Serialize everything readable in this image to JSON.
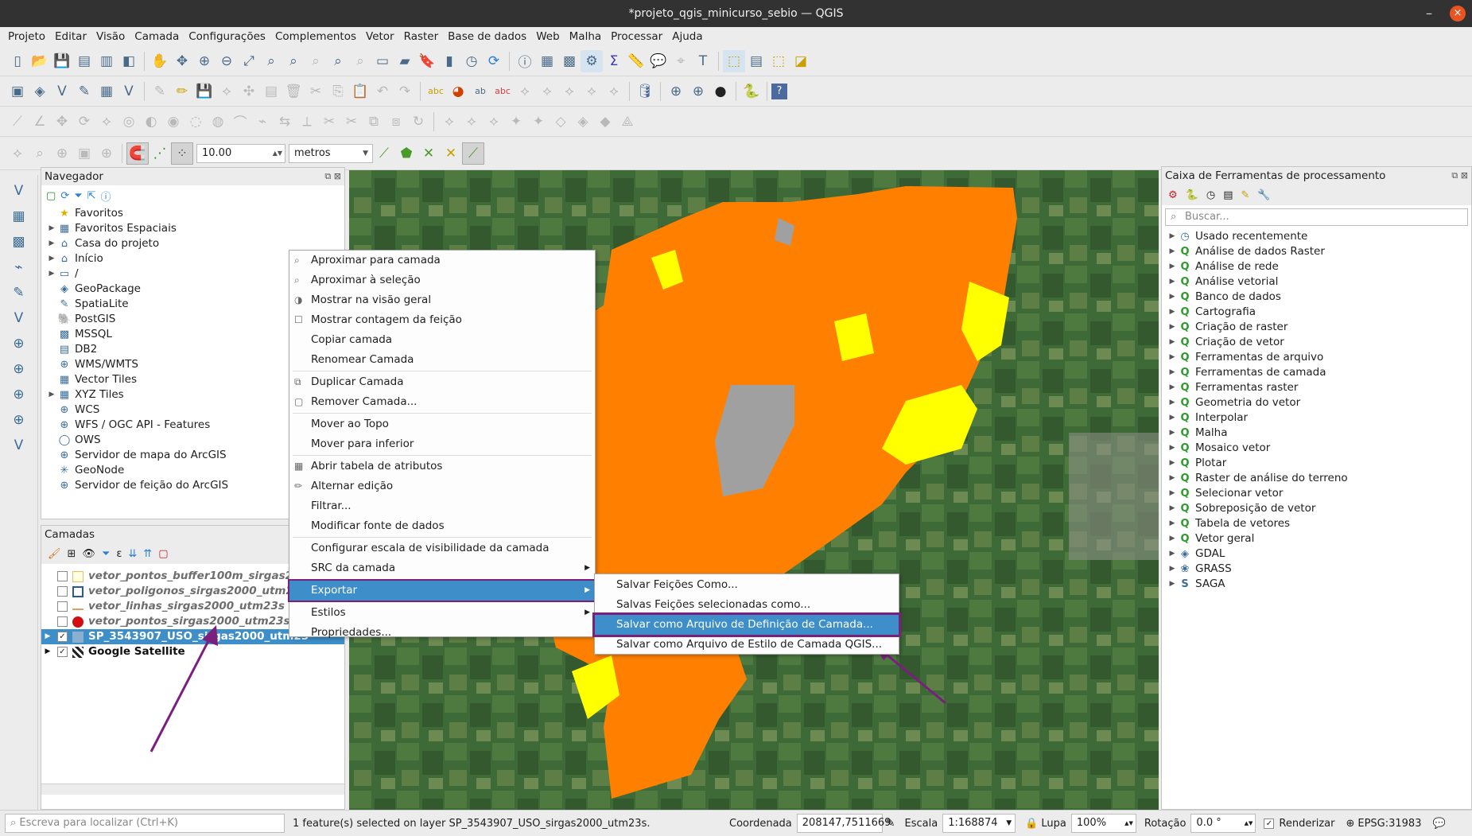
{
  "window": {
    "title": "*projeto_qgis_minicurso_sebio — QGIS",
    "minimize": "–",
    "maximize": "□",
    "close": "×"
  },
  "menubar": [
    "Projeto",
    "Editar",
    "Visão",
    "Camada",
    "Configurações",
    "Complementos",
    "Vetor",
    "Raster",
    "Base de dados",
    "Web",
    "Malha",
    "Processar",
    "Ajuda"
  ],
  "snapping": {
    "tolerance": "10.00",
    "units": "metros"
  },
  "navigator": {
    "title": "Navegador",
    "items": [
      {
        "label": "Favoritos",
        "icon": "star-icon",
        "expand": false
      },
      {
        "label": "Favoritos Espaciais",
        "icon": "spatial-bookmark-icon",
        "expand": true
      },
      {
        "label": "Casa do projeto",
        "icon": "project-home-icon",
        "expand": true
      },
      {
        "label": "Início",
        "icon": "home-icon",
        "expand": true
      },
      {
        "label": "/",
        "icon": "folder-icon",
        "expand": true
      },
      {
        "label": "GeoPackage",
        "icon": "geopackage-icon",
        "expand": false
      },
      {
        "label": "SpatiaLite",
        "icon": "spatialite-icon",
        "expand": false
      },
      {
        "label": "PostGIS",
        "icon": "postgis-icon",
        "expand": false
      },
      {
        "label": "MSSQL",
        "icon": "mssql-icon",
        "expand": false
      },
      {
        "label": "DB2",
        "icon": "db2-icon",
        "expand": false
      },
      {
        "label": "WMS/WMTS",
        "icon": "wms-icon",
        "expand": false
      },
      {
        "label": "Vector Tiles",
        "icon": "vector-tiles-icon",
        "expand": false
      },
      {
        "label": "XYZ Tiles",
        "icon": "xyz-tiles-icon",
        "expand": true
      },
      {
        "label": "WCS",
        "icon": "wcs-icon",
        "expand": false
      },
      {
        "label": "WFS / OGC API - Features",
        "icon": "wfs-icon",
        "expand": false
      },
      {
        "label": "OWS",
        "icon": "ows-icon",
        "expand": false
      },
      {
        "label": "Servidor de mapa do ArcGIS",
        "icon": "arcgis-map-icon",
        "expand": false
      },
      {
        "label": "GeoNode",
        "icon": "geonode-icon",
        "expand": false
      },
      {
        "label": "Servidor de feição do ArcGIS",
        "icon": "arcgis-feature-icon",
        "expand": false
      }
    ]
  },
  "layers": {
    "title": "Camadas",
    "items": [
      {
        "label": "vetor_pontos_buffer100m_sirgas2",
        "checked": false
      },
      {
        "label": "vetor_poligonos_sirgas2000_utm2",
        "checked": false
      },
      {
        "label": "vetor_linhas_sirgas2000_utm23s",
        "checked": false
      },
      {
        "label": "vetor_pontos_sirgas2000_utm23s",
        "checked": false
      },
      {
        "label": "SP_3543907_USO_sirgas2000_utm23",
        "checked": true
      },
      {
        "label": "Google Satellite",
        "checked": true
      }
    ],
    "checkmark": "✓"
  },
  "context_menu": {
    "items": [
      {
        "label": "Aproximar para camada",
        "icon": "zoom-layer-icon"
      },
      {
        "label": "Aproximar à seleção",
        "icon": "zoom-selection-icon"
      },
      {
        "label": "Mostrar na visão geral",
        "icon": "overview-icon"
      },
      {
        "label": "Mostrar contagem da feição",
        "icon": "checkbox-icon"
      },
      {
        "label": "Copiar camada",
        "icon": ""
      },
      {
        "label": "Renomear Camada",
        "icon": ""
      },
      {
        "sep": true
      },
      {
        "label": "Duplicar Camada",
        "icon": "duplicate-icon"
      },
      {
        "label": "Remover Camada...",
        "icon": "remove-icon"
      },
      {
        "sep": true
      },
      {
        "label": "Mover ao Topo",
        "icon": ""
      },
      {
        "label": "Mover para inferior",
        "icon": ""
      },
      {
        "sep": true
      },
      {
        "label": "Abrir tabela de atributos",
        "icon": "table-icon"
      },
      {
        "label": "Alternar edição",
        "icon": "pencil-icon"
      },
      {
        "label": "Filtrar...",
        "icon": ""
      },
      {
        "label": "Modificar fonte de dados",
        "icon": ""
      },
      {
        "sep": true
      },
      {
        "label": "Configurar escala de visibilidade da camada",
        "icon": ""
      },
      {
        "label": "SRC da camada",
        "icon": "",
        "sub": true
      },
      {
        "sep": true
      },
      {
        "label": "Exportar",
        "icon": "",
        "sub": true,
        "hl": true
      },
      {
        "sep": true
      },
      {
        "label": "Estilos",
        "icon": "",
        "sub": true
      },
      {
        "label": "Propriedades...",
        "icon": ""
      }
    ]
  },
  "submenu": [
    {
      "label": "Salvar Feições Como..."
    },
    {
      "label": "Salvas Feições selecionadas como..."
    },
    {
      "label": "Salvar como Arquivo de Definição de Camada...",
      "hl": true
    },
    {
      "label": "Salvar como Arquivo de Estilo de Camada QGIS..."
    }
  ],
  "processing": {
    "title": "Caixa de Ferramentas de processamento",
    "search_placeholder": "Buscar...",
    "items": [
      {
        "label": "Usado recentemente",
        "icon": "clock-icon"
      },
      {
        "label": "Análise de dados Raster",
        "icon": "qgis-icon"
      },
      {
        "label": "Análise de rede",
        "icon": "qgis-icon"
      },
      {
        "label": "Análise vetorial",
        "icon": "qgis-icon"
      },
      {
        "label": "Banco de dados",
        "icon": "qgis-icon"
      },
      {
        "label": "Cartografia",
        "icon": "qgis-icon"
      },
      {
        "label": "Criação de raster",
        "icon": "qgis-icon"
      },
      {
        "label": "Criação de vetor",
        "icon": "qgis-icon"
      },
      {
        "label": "Ferramentas de arquivo",
        "icon": "qgis-icon"
      },
      {
        "label": "Ferramentas de camada",
        "icon": "qgis-icon"
      },
      {
        "label": "Ferramentas raster",
        "icon": "qgis-icon"
      },
      {
        "label": "Geometria do vetor",
        "icon": "qgis-icon"
      },
      {
        "label": "Interpolar",
        "icon": "qgis-icon"
      },
      {
        "label": "Malha",
        "icon": "qgis-icon"
      },
      {
        "label": "Mosaico vetor",
        "icon": "qgis-icon"
      },
      {
        "label": "Plotar",
        "icon": "qgis-icon"
      },
      {
        "label": "Raster de análise do terreno",
        "icon": "qgis-icon"
      },
      {
        "label": "Selecionar vetor",
        "icon": "qgis-icon"
      },
      {
        "label": "Sobreposição de vetor",
        "icon": "qgis-icon"
      },
      {
        "label": "Tabela de vetores",
        "icon": "qgis-icon"
      },
      {
        "label": "Vetor geral",
        "icon": "qgis-icon"
      },
      {
        "label": "GDAL",
        "icon": "gdal-icon"
      },
      {
        "label": "GRASS",
        "icon": "grass-icon"
      },
      {
        "label": "SAGA",
        "icon": "saga-icon"
      }
    ]
  },
  "statusbar": {
    "locator_placeholder": "Escreva para localizar (Ctrl+K)",
    "message": "1 feature(s) selected on layer SP_3543907_USO_sirgas2000_utm23s.",
    "coord_label": "Coordenada",
    "coord_value": "208147,7511669",
    "scale_label": "Escala",
    "scale_value": "1:168874",
    "magnifier_label": "Lupa",
    "magnifier_value": "100%",
    "rotation_label": "Rotação",
    "rotation_value": "0.0 °",
    "render_label": "Renderizar",
    "crs": "EPSG:31983"
  },
  "colors": {
    "accent": "#3d8ec9",
    "annotation": "#7a1f7e",
    "landuse_urban": "#ff8000",
    "landuse_veg": "#ffff00",
    "water": "#9e9e9e"
  }
}
